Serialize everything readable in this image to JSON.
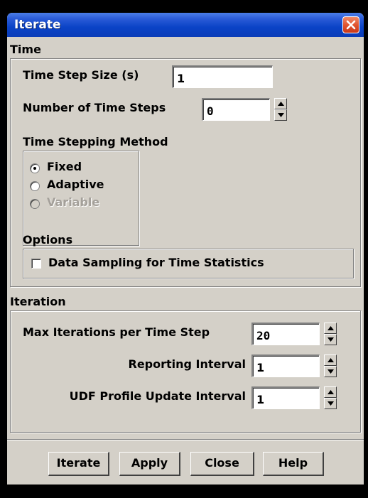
{
  "window": {
    "title": "Iterate"
  },
  "time": {
    "section_label": "Time",
    "time_step_size_label": "Time Step Size (s)",
    "time_step_size_value": "1",
    "num_time_steps_label": "Number of Time Steps",
    "num_time_steps_value": "0",
    "method_label": "Time Stepping Method",
    "methods": [
      {
        "label": "Fixed",
        "selected": true,
        "enabled": true
      },
      {
        "label": "Adaptive",
        "selected": false,
        "enabled": true
      },
      {
        "label": "Variable",
        "selected": false,
        "enabled": false
      }
    ],
    "options_label": "Options",
    "data_sampling_label": "Data Sampling for Time Statistics",
    "data_sampling_checked": false
  },
  "iteration": {
    "section_label": "Iteration",
    "max_iter_label": "Max Iterations per Time Step",
    "max_iter_value": "20",
    "reporting_label": "Reporting Interval",
    "reporting_value": "1",
    "udf_label": "UDF Profile Update Interval",
    "udf_value": "1"
  },
  "buttons": {
    "iterate": "Iterate",
    "apply": "Apply",
    "close": "Close",
    "help": "Help"
  },
  "colors": {
    "titlebar": "#0a43c6",
    "dialog_bg": "#d4d0c8",
    "close_button": "#e0522c"
  }
}
